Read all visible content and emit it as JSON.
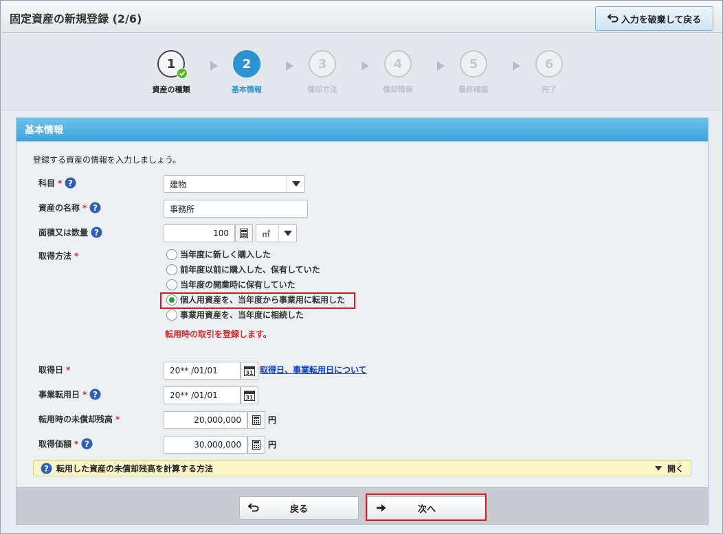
{
  "header": {
    "title": "固定資産の新規登録 (2/6)",
    "discard_label": "入力を破棄して戻る"
  },
  "stepper": {
    "steps": [
      {
        "number": "1",
        "label": "資産の種類",
        "state": "done"
      },
      {
        "number": "2",
        "label": "基本情報",
        "state": "active"
      },
      {
        "number": "3",
        "label": "償却方法",
        "state": "pending"
      },
      {
        "number": "4",
        "label": "償却情報",
        "state": "pending"
      },
      {
        "number": "5",
        "label": "最終確認",
        "state": "pending"
      },
      {
        "number": "6",
        "label": "完了",
        "state": "pending"
      }
    ]
  },
  "panel": {
    "title": "基本情報",
    "intro": "登録する資産の情報を入力しましょう。",
    "required_mark": "*",
    "fields": {
      "subject": {
        "label": "科目",
        "value": "建物"
      },
      "name": {
        "label": "資産の名称",
        "value": "事務所"
      },
      "area": {
        "label": "面積又は数量",
        "value": "100",
        "unit": "㎡"
      },
      "acquisition_method": {
        "label": "取得方法",
        "options": [
          "当年度に新しく購入した",
          "前年度以前に購入した、保有していた",
          "当年度の開業時に保有していた",
          "個人用資産を、当年度から事業用に転用した",
          "事業用資産を、当年度に相続した"
        ],
        "selected_index": 3,
        "notice": "転用時の取引を登録します。"
      },
      "acquisition_date": {
        "label": "取得日",
        "value": "20** /01/01",
        "link": "取得日、事業転用日について"
      },
      "conversion_date": {
        "label": "事業転用日",
        "value": "20** /01/01"
      },
      "undepreciated_balance": {
        "label": "転用時の未償却残高",
        "value": "20,000,000",
        "currency": "円"
      },
      "acquisition_price": {
        "label": "取得価額",
        "value": "30,000,000",
        "currency": "円"
      }
    },
    "accordion": {
      "label": "転用した資産の未償却残高を計算する方法",
      "toggle": "開く"
    }
  },
  "footer": {
    "back_label": "戻る",
    "next_label": "次へ"
  },
  "colors": {
    "accent": "#2a93d2",
    "required": "#e0242a",
    "highlight": "#e0161c",
    "link": "#0d3fd6"
  }
}
